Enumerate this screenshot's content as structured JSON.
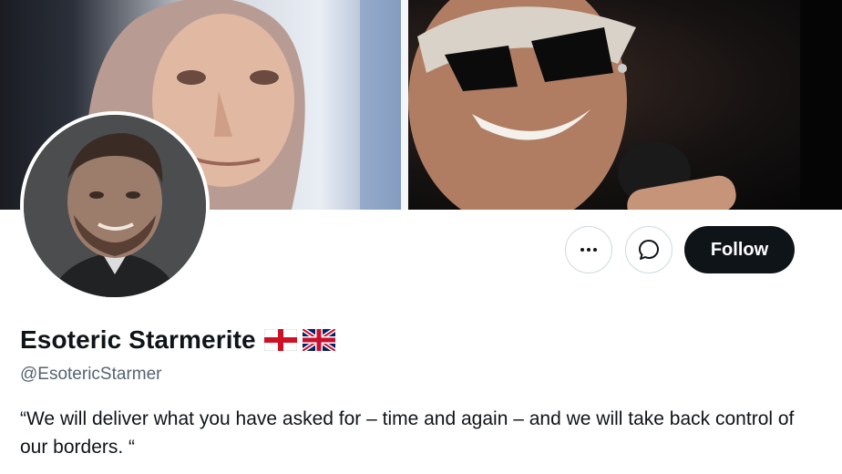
{
  "profile": {
    "display_name": "Esoteric Starmerite",
    "handle": "@EsotericStarmer",
    "bio": "“We will deliver what you have asked for – time and again – and we will take back control of our borders. “",
    "flags": [
      "england-flag-icon",
      "uk-flag-icon"
    ]
  },
  "actions": {
    "more_icon": "more-horizontal-icon",
    "message_icon": "message-icon",
    "follow_label": "Follow"
  },
  "colors": {
    "text_primary": "#0f1419",
    "text_secondary": "#536471",
    "button_dark": "#0f1419",
    "border": "#cfd9de"
  }
}
